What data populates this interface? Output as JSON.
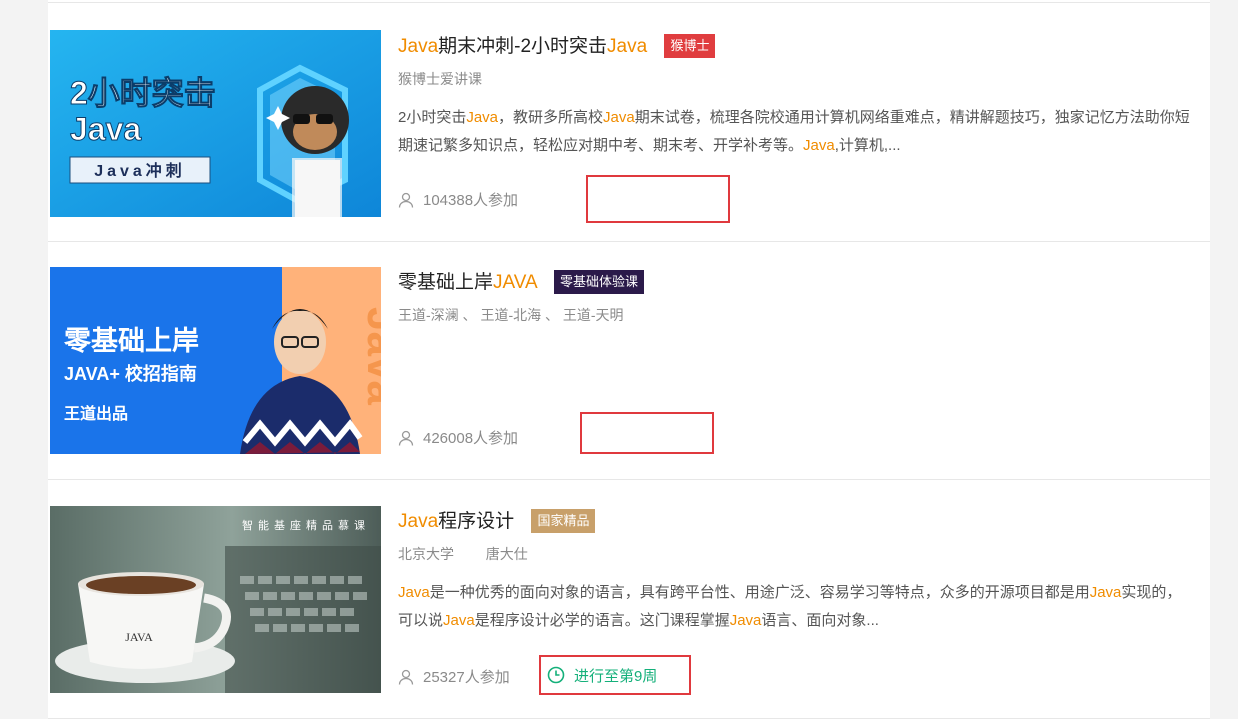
{
  "courses": [
    {
      "title_pre": "",
      "title_kw": "Java",
      "title_mid": "期末冲刺-2小时突击",
      "title_kw2": "Java",
      "badge": "猴博士",
      "badge_color": "#e03d3f",
      "teachers": "猴博士爱讲课",
      "desc_parts": [
        "2小时突击",
        "Java",
        "，教研多所高校",
        "Java",
        "期末试卷，梳理各院校通用计算机网络重难点，精讲解题技巧，独家记忆方法助你短期速记繁多知识点，轻松应对期中考、期末考、开学补考等。",
        "Java",
        ",计算机,..."
      ],
      "enrolled": "104388人参加",
      "thumb": {
        "line1": "2小时突击",
        "line2": "Java",
        "label": "Java冲刺"
      }
    },
    {
      "title_pre": "零基础上岸",
      "title_kw": "JAVA",
      "badge": "零基础体验课",
      "badge_color": "#2b1a4a",
      "teachers": "王道-深澜 、 王道-北海 、 王道-天明",
      "enrolled": "426008人参加",
      "thumb": {
        "line1": "零基础上岸",
        "line2": "JAVA+ 校招指南",
        "line3": "王道出品",
        "side": "Java"
      }
    },
    {
      "title_pre": "",
      "title_kw": "Java",
      "title_mid": "程序设计",
      "badge": "国家精品",
      "badge_color": "#c8a06a",
      "teachers_school": "北京大学",
      "teachers_name": "唐大仕",
      "desc_parts": [
        "Java",
        "是一种优秀的面向对象的语言，具有跨平台性、用途广泛、容易学习等特点，众多的开源项目都是用",
        "Java",
        "实现的，可以说",
        "Java",
        "是程序设计必学的语言。这门课程掌握",
        "Java",
        "语言、面向对象..."
      ],
      "enrolled": "25327人参加",
      "progress": "进行至第9周",
      "thumb": {
        "banner": "智能基座精品慕课",
        "cup": "JAVA"
      }
    }
  ]
}
